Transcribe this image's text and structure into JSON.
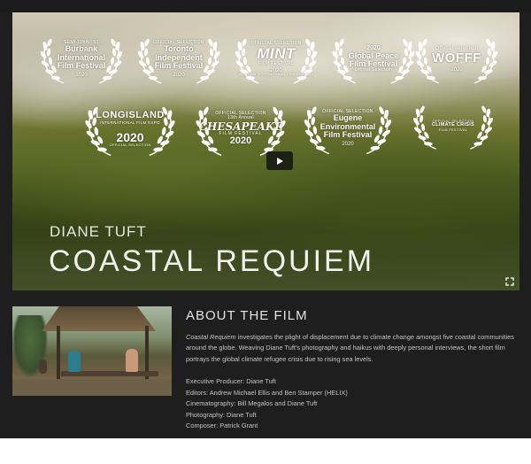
{
  "film": {
    "director": "DIANE TUFT",
    "title": "COASTAL REQUIEM"
  },
  "laurels": [
    {
      "id": "burbank",
      "lines": [
        "SEMI-FINALIST",
        "Burbank",
        "International",
        "Film Festival",
        "2020"
      ]
    },
    {
      "id": "toronto",
      "lines": [
        "OFFICIAL SELECTION",
        "Toronto",
        "Independent",
        "Film Festival",
        "2020"
      ]
    },
    {
      "id": "mint",
      "lines": [
        "OFFICIAL SELECTION",
        "MINT",
        "FILM FESTIVAL",
        "2020",
        "MONTANA INTERNATIONAL FILM FESTIVAL"
      ]
    },
    {
      "id": "global-peace",
      "lines": [
        "2020",
        "Global Peace",
        "Film Festival",
        "Official Selection"
      ]
    },
    {
      "id": "wofff",
      "lines": [
        "Official selection",
        "WOFFF",
        "2020"
      ]
    },
    {
      "id": "long-island",
      "lines": [
        "LONGISLAND",
        "INTERNATIONAL FILM EXPO",
        "2020",
        "OFFICIAL SELECTION"
      ]
    },
    {
      "id": "chesapeake",
      "lines": [
        "OFFICIAL SELECTION",
        "13th Annual",
        "CHESAPEAKE",
        "FILM FESTIVAL",
        "2020"
      ]
    },
    {
      "id": "eugene",
      "lines": [
        "OFFICIAL SELECTION",
        "Eugene",
        "Environmental",
        "Film Festival",
        "2020"
      ]
    },
    {
      "id": "climate-crisis",
      "lines": [
        "OFFICIAL SELECTION",
        "CLIMATE CRISIS",
        "FILM FESTIVAL"
      ]
    }
  ],
  "about": {
    "heading": "ABOUT THE FILM",
    "title_italic": "Coastal Requiem",
    "synopsis": " investigates the plight of displacement due to climate change amongst five coastal communities around the globe. Weaving Diane Tuft's photography and haikus with deeply personal interviews, the short film portrays the global climate refugee crisis due to rising sea levels.",
    "credits": [
      "Executive Producer: Diane Tuft",
      "Editors: Andrew Michael Ellis and Ben Stamper (HELIX)",
      "Cinematography: Bill Megalos and Diane Tuft",
      "Photography: Diane Tuft",
      "Composer: Patrick Grant"
    ]
  },
  "icons": {
    "play": "play-icon",
    "fullscreen": "fullscreen-icon"
  }
}
